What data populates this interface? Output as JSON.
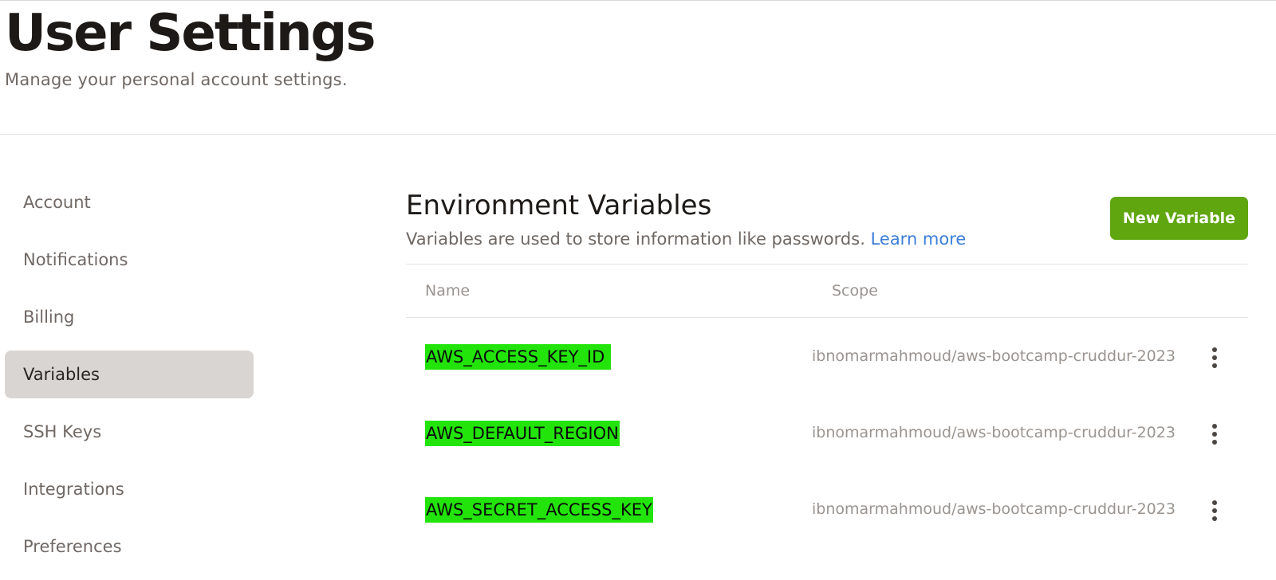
{
  "header": {
    "title": "User Settings",
    "subtitle": "Manage your personal account settings."
  },
  "sidebar": {
    "items": [
      {
        "label": "Account",
        "active": false
      },
      {
        "label": "Notifications",
        "active": false
      },
      {
        "label": "Billing",
        "active": false
      },
      {
        "label": "Variables",
        "active": true
      },
      {
        "label": "SSH Keys",
        "active": false
      },
      {
        "label": "Integrations",
        "active": false
      },
      {
        "label": "Preferences",
        "active": false
      }
    ]
  },
  "main": {
    "title": "Environment Variables",
    "description": "Variables are used to store information like passwords.",
    "learn_more": "Learn more",
    "new_button": "New Variable",
    "table": {
      "columns": [
        "Name",
        "Scope"
      ],
      "rows": [
        {
          "name": "AWS_ACCESS_KEY_ID ",
          "scope": "ibnomarmahmoud/aws-bootcamp-cruddur-2023"
        },
        {
          "name": "AWS_DEFAULT_REGION",
          "scope": "ibnomarmahmoud/aws-bootcamp-cruddur-2023"
        },
        {
          "name": "AWS_SECRET_ACCESS_KEY",
          "scope": "ibnomarmahmoud/aws-bootcamp-cruddur-2023"
        }
      ]
    }
  },
  "colors": {
    "primary_button": "#5fa60f",
    "link": "#3c7fd9",
    "highlight": "#22e40a",
    "active_nav": "#d9d5d2"
  },
  "icons": {
    "row_menu": "more-vertical-icon"
  }
}
